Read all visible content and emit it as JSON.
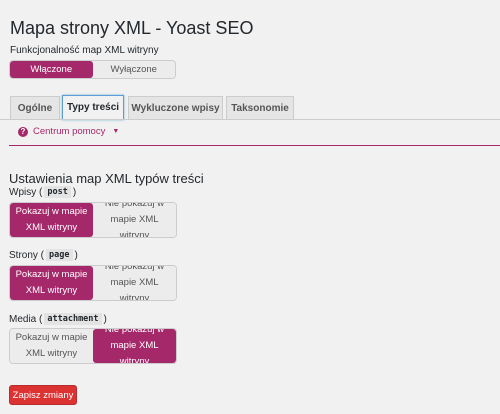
{
  "page": {
    "title": "Mapa strony XML - Yoast SEO"
  },
  "master": {
    "label": "Funkcjonalność map XML witryny",
    "on_label": "Włączone",
    "off_label": "Wyłączone",
    "state": "on"
  },
  "tabs": [
    {
      "label": "Ogólne",
      "active": false
    },
    {
      "label": "Typy treści",
      "active": true
    },
    {
      "label": "Wykluczone wpisy",
      "active": false
    },
    {
      "label": "Taksonomie",
      "active": false
    }
  ],
  "help": {
    "label": "Centrum pomocy",
    "icon": "question-circle-icon"
  },
  "section": {
    "title": "Ustawienia map XML typów treści"
  },
  "post_types": [
    {
      "name": "Wpisy",
      "slug": "post",
      "show_label": "Pokazuj w mapie XML witryny",
      "hide_label": "Nie pokazuj w mapie XML witryny",
      "state": "show"
    },
    {
      "name": "Strony",
      "slug": "page",
      "show_label": "Pokazuj w mapie XML witryny",
      "hide_label": "Nie pokazuj w mapie XML witryny",
      "state": "show"
    },
    {
      "name": "Media",
      "slug": "attachment",
      "show_label": "Pokazuj w mapie XML witryny",
      "hide_label": "Nie pokazuj w mapie XML witryny",
      "state": "hide"
    }
  ],
  "actions": {
    "save_label": "Zapisz zmiany"
  },
  "colors": {
    "accent": "#a4286a",
    "danger": "#dc3232"
  }
}
